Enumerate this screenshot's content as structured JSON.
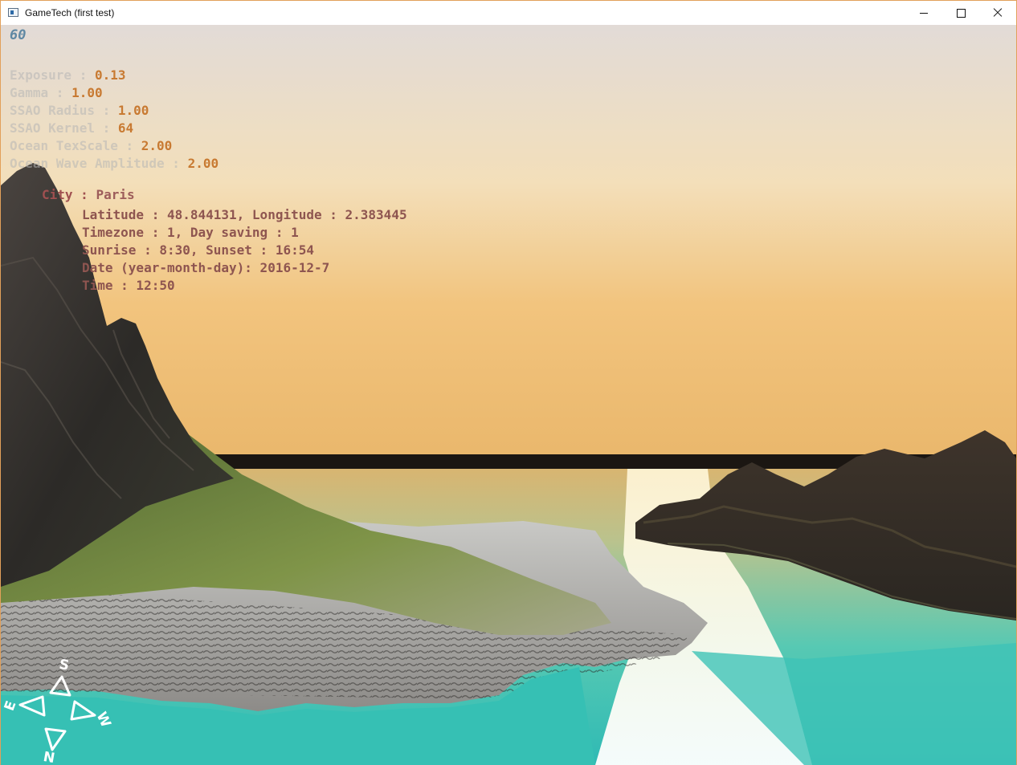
{
  "window": {
    "title": "GameTech (first test)",
    "controls": {
      "minimize": "minimize",
      "maximize": "maximize",
      "close": "close"
    }
  },
  "hud": {
    "fps": "60",
    "params": [
      {
        "label": "Exposure : ",
        "value": "0.13"
      },
      {
        "label": "Gamma : ",
        "value": "1.00"
      },
      {
        "label": "SSAO Radius : ",
        "value": "1.00"
      },
      {
        "label": "SSAO Kernel : ",
        "value": "64"
      },
      {
        "label": "Ocean TexScale : ",
        "value": "2.00"
      },
      {
        "label": "Ocean Wave Amplitude : ",
        "value": "2.00"
      }
    ],
    "city_label": "City : ",
    "city_value": "Paris",
    "info_lines": [
      "Latitude : 48.844131, Longitude : 2.383445",
      "Timezone : 1, Day saving : 1",
      "Sunrise : 8:30, Sunset : 16:54",
      "Date (year-month-day): 2016-12-7",
      "Time : 12:50"
    ]
  },
  "compass": {
    "south": "S",
    "east": "E",
    "west": "W",
    "north": "N"
  },
  "colors": {
    "sky_top": "#e3dcd6",
    "sky_horizon": "#f0c37a",
    "water": "#33c2b6",
    "param_value": "#c87a32",
    "city_text": "#a05050",
    "fps": "#5f88a3"
  }
}
